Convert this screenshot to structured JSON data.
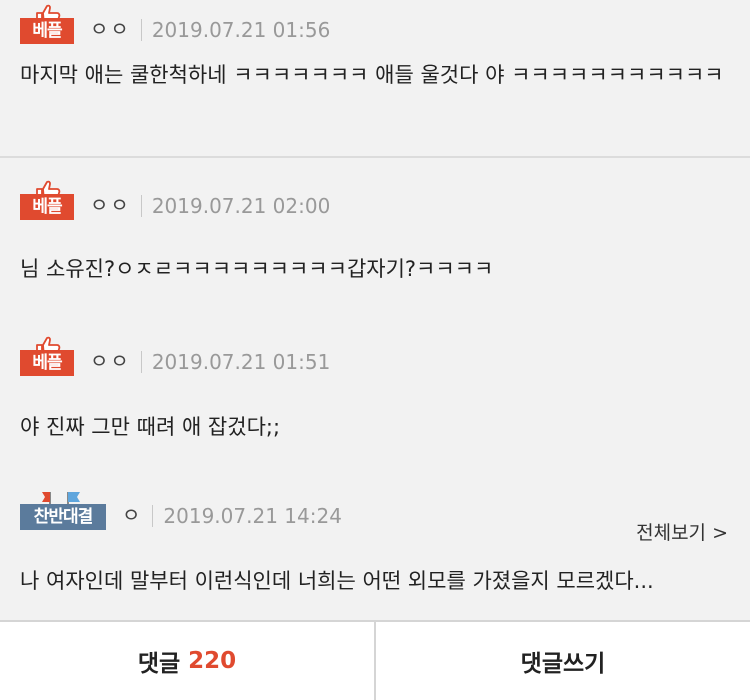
{
  "comments": [
    {
      "badge": "베플",
      "nickname": "ㅇㅇ",
      "date": "2019.07.21 01:56",
      "text": "마지막 애는 쿨한척하네 ㅋㅋㅋㅋㅋㅋㅋ 애들 울것다 야 ㅋㅋㅋㅋㅋㅋㅋㅋㅋㅋㅋ"
    },
    {
      "badge": "베플",
      "nickname": "ㅇㅇ",
      "date": "2019.07.21 02:00",
      "text": "님 소유진?ㅇㅈㄹㅋㅋㅋㅋㅋㅋㅋㅋㅋ갑자기?ㅋㅋㅋㅋ"
    },
    {
      "badge": "베플",
      "nickname": "ㅇㅇ",
      "date": "2019.07.21 01:51",
      "text": "야 진짜 그만 때려 애 잡겄다;;"
    },
    {
      "badge": "찬반대결",
      "nickname": "ㅇ",
      "date": "2019.07.21 14:24",
      "more": "전체보기 >",
      "text": "나 여자인데 말부터 이런식인데 너희는 어떤 외모를 가졌을지 모르겠다..."
    }
  ],
  "footer": {
    "comments_label": "댓글",
    "comments_count": "220",
    "write_label": "댓글쓰기"
  },
  "colors": {
    "best_badge": "#e04a2f",
    "versus_badge": "#5b7b9c",
    "count": "#e04a2f"
  }
}
